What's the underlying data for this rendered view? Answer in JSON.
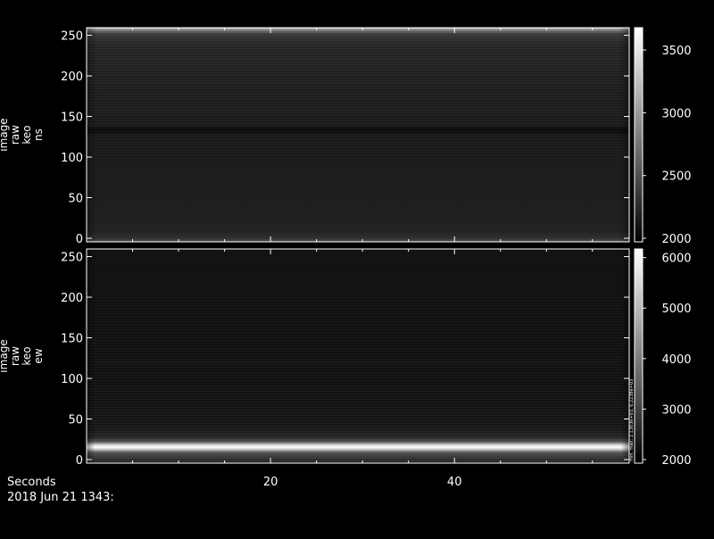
{
  "colors": {
    "background": "#000000",
    "foreground": "#ffffff"
  },
  "time_axis": {
    "label": "Seconds",
    "ticks": [
      20,
      40
    ],
    "range": [
      0,
      59
    ],
    "timestamp": "2018 Jun 21 1343:"
  },
  "chart_data": [
    {
      "type": "heatmap",
      "title": "",
      "ylabel_lines": [
        "image",
        "raw",
        "keo",
        "ns"
      ],
      "x_range": [
        0,
        59
      ],
      "y_range": [
        0,
        255
      ],
      "y_ticks": [
        0,
        50,
        100,
        150,
        200,
        250
      ],
      "colorbar": {
        "range": [
          2000,
          3650
        ],
        "ticks": [
          2000,
          2500,
          3000,
          3500
        ]
      },
      "features": [
        {
          "y_range": [
            252,
            255
          ],
          "description_value": 3650
        },
        {
          "y_range": [
            130,
            134
          ],
          "description_value": 2050
        }
      ]
    },
    {
      "type": "heatmap",
      "title": "",
      "ylabel_lines": [
        "image",
        "raw",
        "keo",
        "ew"
      ],
      "x_range": [
        0,
        59
      ],
      "y_range": [
        0,
        255
      ],
      "y_ticks": [
        0,
        50,
        100,
        150,
        200,
        250
      ],
      "colorbar": {
        "range": [
          2000,
          6100
        ],
        "ticks": [
          2000,
          3000,
          4000,
          5000,
          6000
        ],
        "side_label": "min. max: 2.1303e+03, 6.2238e+03"
      },
      "features": [
        {
          "y_range": [
            13,
            19
          ],
          "description_value": 6000
        }
      ]
    }
  ]
}
